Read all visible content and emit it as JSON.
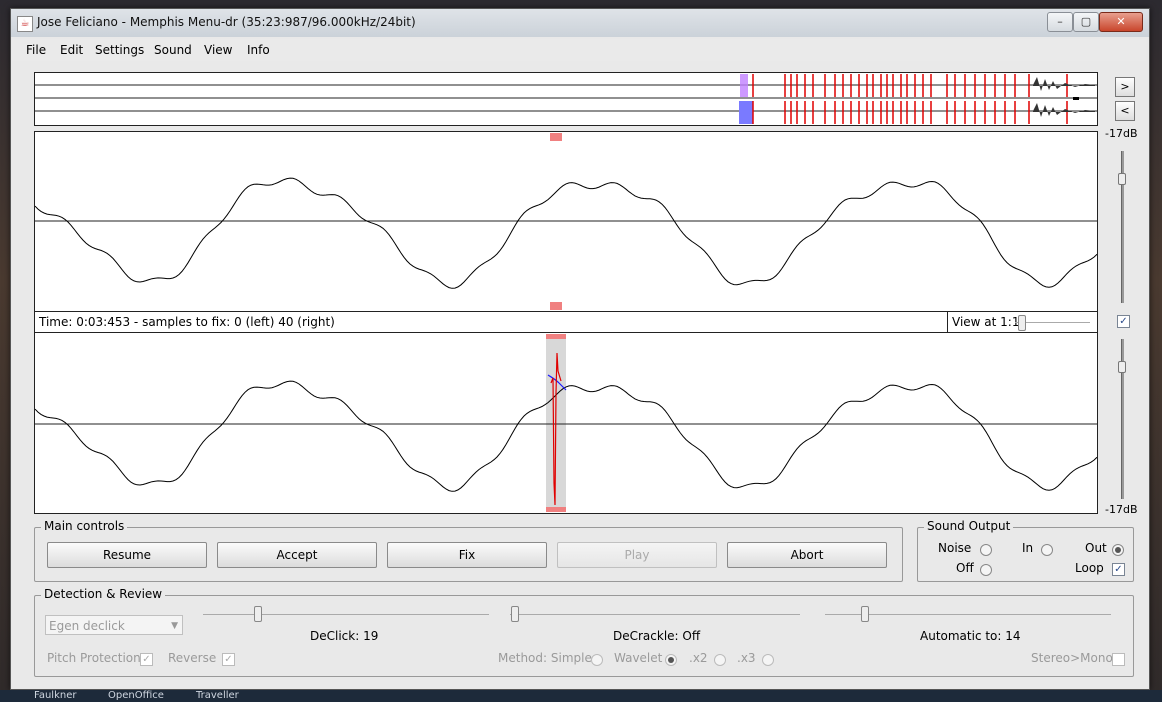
{
  "window": {
    "title": "Jose Feliciano - Memphis Menu-dr (35:23:987/96.000kHz/24bit)",
    "icon": "java-cup-icon"
  },
  "menu": [
    "File",
    "Edit",
    "Settings",
    "Sound",
    "View",
    "Info"
  ],
  "overview": {
    "next_label": ">",
    "prev_label": "<"
  },
  "levels": {
    "top_db": "-17dB",
    "bottom_db": "-17dB"
  },
  "status": {
    "text": "Time: 0:03:453 - samples to fix: 0 (left) 40 (right)",
    "view_label": "View at 1:1",
    "view_checked": true
  },
  "main_controls": {
    "title": "Main controls",
    "buttons": [
      "Resume",
      "Accept",
      "Fix",
      "Play",
      "Abort"
    ],
    "play_enabled": false
  },
  "sound_output": {
    "title": "Sound Output",
    "noise": "Noise",
    "in": "In",
    "out": "Out",
    "off": "Off",
    "loop": "Loop",
    "selected": "Out",
    "loop_checked": true
  },
  "detection": {
    "title": "Detection & Review",
    "combo_value": "Egen declick",
    "declick_label": "DeClick: 19",
    "decrackle_label": "DeCrackle: Off",
    "automatic_label": "Automatic to: 14",
    "pitch_protection": "Pitch Protection",
    "reverse": "Reverse",
    "method_simple": "Method: Simple",
    "wavelet": "Wavelet",
    "x2": ".x2",
    "x3": ".x3",
    "stereo_mono": "Stereo>Mono",
    "selected_method": "Wavelet"
  },
  "colors": {
    "marker": "#f08080",
    "click_red": "#e00000",
    "repair_blue": "#1a1aff",
    "overview_blue": "#7a7aff"
  },
  "taskbar": [
    "Faulkner",
    "OpenOffice",
    "Traveller"
  ]
}
